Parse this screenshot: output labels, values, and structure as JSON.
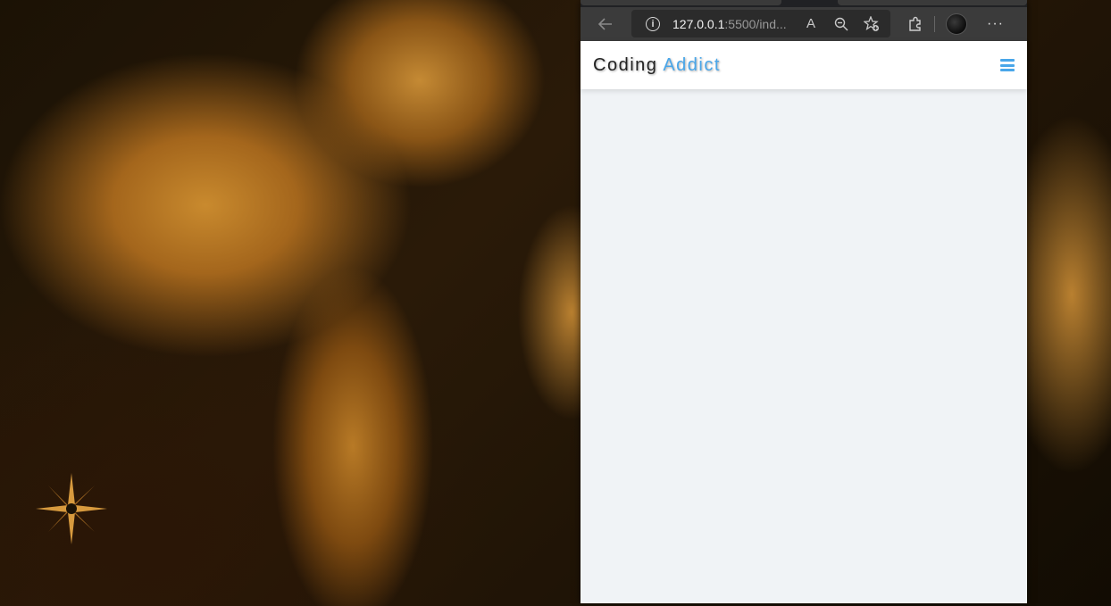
{
  "browser": {
    "url_host": "127.0.0.1",
    "url_rest": ":5500/ind...",
    "icons": {
      "back": "arrow-left-icon",
      "info": "info-icon",
      "read_aloud": "read-aloud-icon",
      "zoom": "zoom-out-icon",
      "favorites": "add-favorite-icon",
      "extensions": "puzzle-icon",
      "profile": "avatar",
      "more": "more-icon"
    },
    "read_aloud_glyph": "A",
    "more_glyph": "···",
    "info_glyph": "i"
  },
  "page": {
    "logo_word1": "Coding",
    "logo_word2": "Addict",
    "accent_color": "#49a6e9",
    "background_color": "#f0f3f6"
  }
}
